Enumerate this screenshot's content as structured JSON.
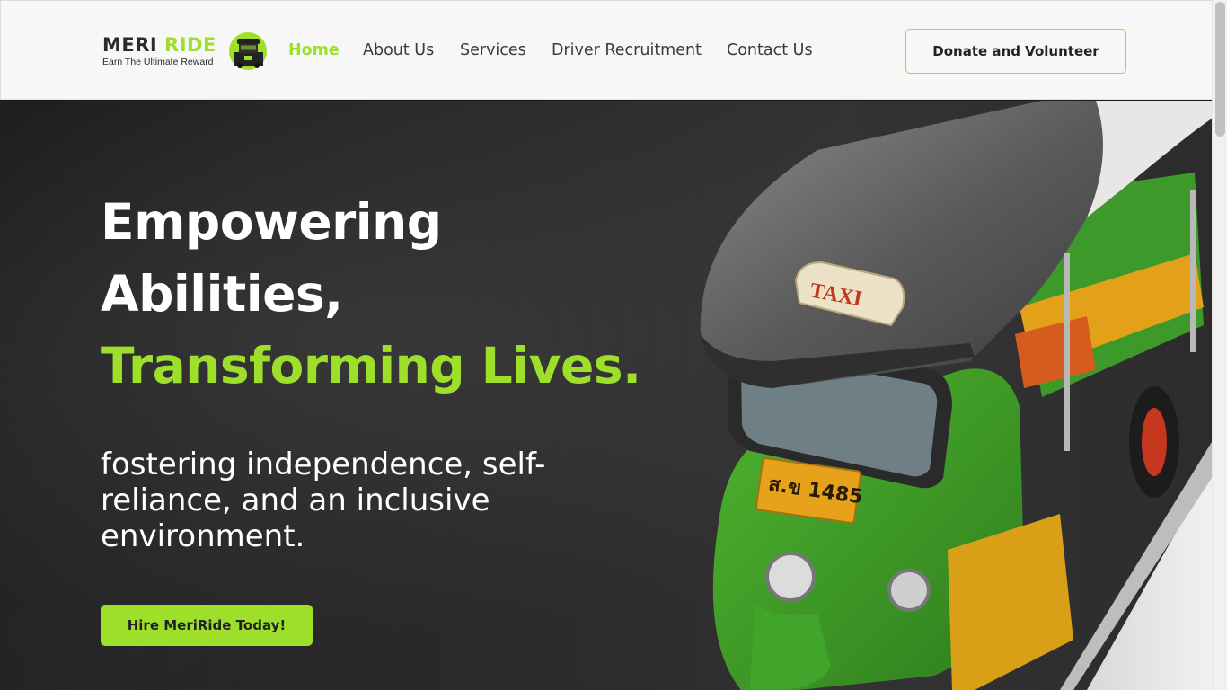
{
  "header": {
    "logo": {
      "word_dark": "MERI ",
      "word_accent": "RIDE",
      "tagline": "Earn The Ultimate Reward"
    },
    "nav": [
      {
        "label": "Home",
        "active": true
      },
      {
        "label": "About Us",
        "active": false
      },
      {
        "label": "Services",
        "active": false
      },
      {
        "label": "Driver Recruitment",
        "active": false
      },
      {
        "label": "Contact Us",
        "active": false
      }
    ],
    "cta_label": "Donate and Volunteer"
  },
  "hero": {
    "headline_line1": "Empowering",
    "headline_line2": "Abilities,",
    "headline_line3": "Transforming Lives.",
    "subtext": "fostering independence, self-reliance, and an inclusive environment.",
    "cta_label": "Hire MeriRide Today!",
    "photo_sign_text": "TAXI",
    "photo_plate_text": "ส.ข 1485"
  },
  "colors": {
    "accent": "#9ddf2a",
    "header_bg": "#f7f7f7",
    "hero_bg": "#1f1f1f",
    "text_dark": "#2b2b2b"
  },
  "icons": {
    "logo_mark": "tuk-tuk-logo-icon"
  }
}
